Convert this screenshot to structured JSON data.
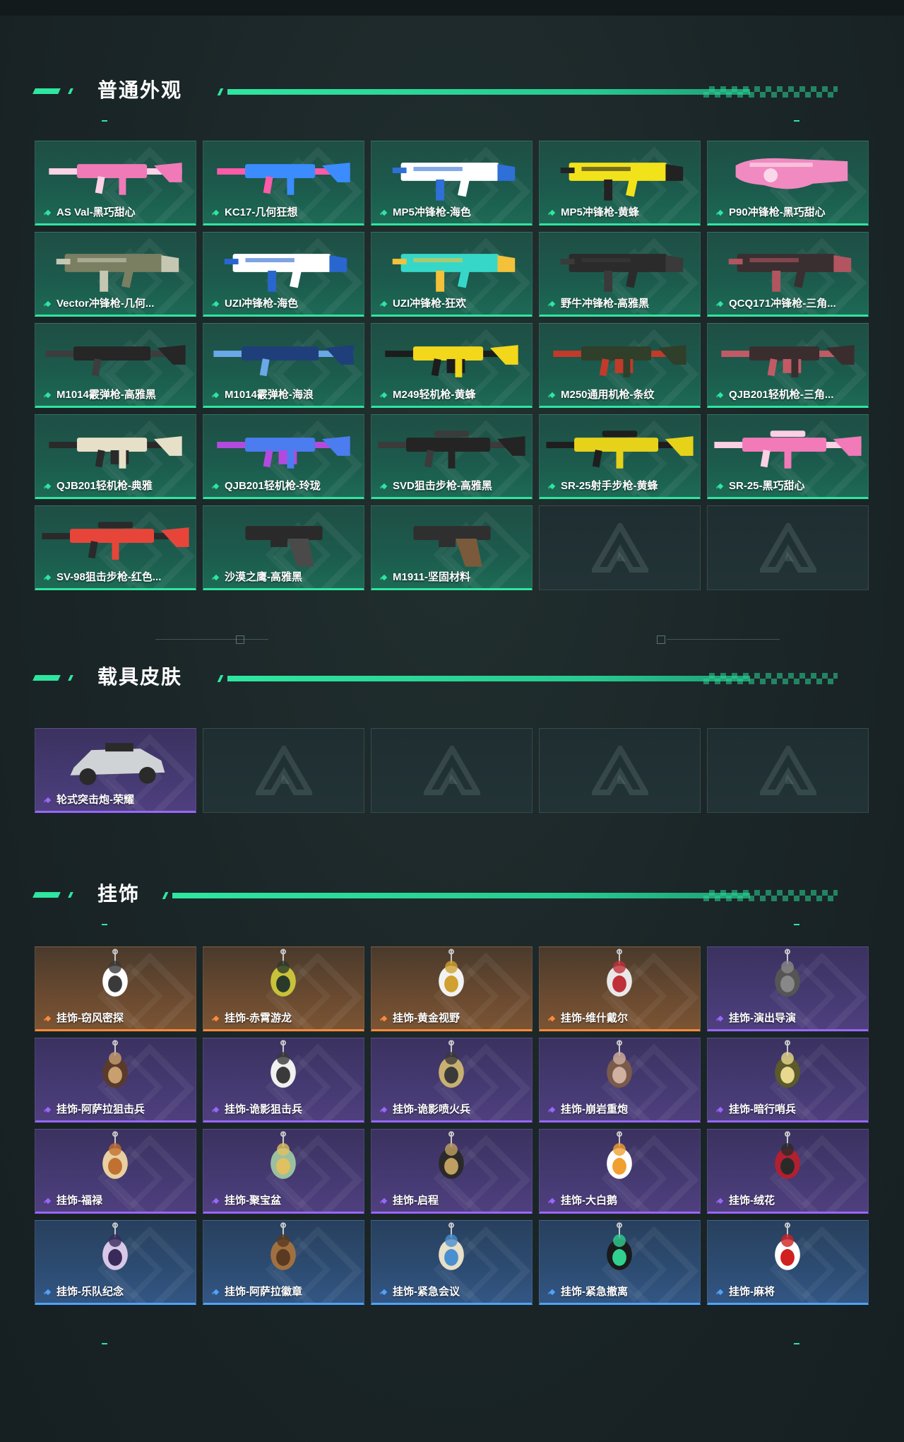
{
  "sections": [
    {
      "title": "普通外观",
      "rarity": "green",
      "items": [
        {
          "label": "AS Val-黑巧甜心",
          "kind": "rifle",
          "colors": [
            "#f07ab8",
            "#fbd2e6"
          ]
        },
        {
          "label": "KC17-几何狂想",
          "kind": "rifle",
          "colors": [
            "#3b8cff",
            "#ff5aa8"
          ]
        },
        {
          "label": "MP5冲锋枪-海色",
          "kind": "smg",
          "colors": [
            "#ffffff",
            "#2f6fd8"
          ]
        },
        {
          "label": "MP5冲锋枪-黄蜂",
          "kind": "smg",
          "colors": [
            "#f2e21a",
            "#222222"
          ]
        },
        {
          "label": "P90冲锋枪-黑巧甜心",
          "kind": "p90",
          "colors": [
            "#f08ac0",
            "#fbd7ea"
          ]
        },
        {
          "label": "Vector冲锋枪-几何...",
          "kind": "smg",
          "colors": [
            "#7a7f62",
            "#c6c7b3"
          ]
        },
        {
          "label": "UZI冲锋枪-海色",
          "kind": "smg",
          "colors": [
            "#ffffff",
            "#2a66d0"
          ]
        },
        {
          "label": "UZI冲锋枪-狂欢",
          "kind": "smg",
          "colors": [
            "#36d7c8",
            "#f3c13a"
          ]
        },
        {
          "label": "野牛冲锋枪-高雅黑",
          "kind": "smg",
          "colors": [
            "#2b2b2b",
            "#3a3a3a"
          ]
        },
        {
          "label": "QCQ171冲锋枪-三角...",
          "kind": "smg",
          "colors": [
            "#3a2f30",
            "#b25560"
          ]
        },
        {
          "label": "M1014霰弹枪-高雅黑",
          "kind": "shotgun",
          "colors": [
            "#262626",
            "#3d3d3d"
          ]
        },
        {
          "label": "M1014霰弹枪-海浪",
          "kind": "shotgun",
          "colors": [
            "#1f3f7a",
            "#6aa8e8"
          ]
        },
        {
          "label": "M249轻机枪-黄蜂",
          "kind": "lmg",
          "colors": [
            "#f2d71a",
            "#1c1c1c"
          ]
        },
        {
          "label": "M250通用机枪-条纹",
          "kind": "lmg",
          "colors": [
            "#2f3f2a",
            "#c23a2a"
          ]
        },
        {
          "label": "QJB201轻机枪-三角...",
          "kind": "lmg",
          "colors": [
            "#3a2d2e",
            "#c25a66"
          ]
        },
        {
          "label": "QJB201轻机枪-典雅",
          "kind": "lmg",
          "colors": [
            "#e7e0c8",
            "#2a2a2a"
          ]
        },
        {
          "label": "QJB201轻机枪-玲珑",
          "kind": "lmg",
          "colors": [
            "#4b7cf0",
            "#b34ae0"
          ]
        },
        {
          "label": "SVD狙击步枪-高雅黑",
          "kind": "sniper",
          "colors": [
            "#242424",
            "#3b3b3b"
          ]
        },
        {
          "label": "SR-25射手步枪-黄蜂",
          "kind": "sniper",
          "colors": [
            "#e7d21a",
            "#1e1e1e"
          ]
        },
        {
          "label": "SR-25-黑巧甜心",
          "kind": "sniper",
          "colors": [
            "#f27ab8",
            "#fbd0e4"
          ]
        },
        {
          "label": "SV-98狙击步枪-红色...",
          "kind": "sniper",
          "colors": [
            "#e8453a",
            "#2a2a2a"
          ]
        },
        {
          "label": "沙漠之鹰-高雅黑",
          "kind": "pistol",
          "colors": [
            "#2a2a2a",
            "#4a4a4a"
          ]
        },
        {
          "label": "M1911-坚固材料",
          "kind": "pistol",
          "colors": [
            "#2f2f2f",
            "#7a5a3a"
          ]
        },
        {
          "label": "",
          "kind": "empty"
        },
        {
          "label": "",
          "kind": "empty"
        }
      ]
    },
    {
      "title": "载具皮肤",
      "rarity": "purple",
      "items": [
        {
          "label": "轮式突击炮-荣耀",
          "kind": "vehicle",
          "colors": [
            "#cfd3d6",
            "#2a2a2a"
          ]
        },
        {
          "label": "",
          "kind": "empty"
        },
        {
          "label": "",
          "kind": "empty"
        },
        {
          "label": "",
          "kind": "empty"
        },
        {
          "label": "",
          "kind": "empty"
        }
      ]
    },
    {
      "title": "挂饰",
      "items": [
        {
          "label": "挂饰-窃风密探",
          "kind": "charm",
          "rarity": "orange",
          "colors": [
            "#ffffff",
            "#3a3a3a"
          ]
        },
        {
          "label": "挂饰-赤霄游龙",
          "kind": "charm",
          "rarity": "orange",
          "colors": [
            "#c8c23a",
            "#2a3a2a"
          ]
        },
        {
          "label": "挂饰-黄金视野",
          "kind": "charm",
          "rarity": "orange",
          "colors": [
            "#f2f2f2",
            "#d0a030"
          ]
        },
        {
          "label": "挂饰-维什戴尔",
          "kind": "charm",
          "rarity": "orange",
          "colors": [
            "#e8e8e8",
            "#c0303a"
          ]
        },
        {
          "label": "挂饰-演出导演",
          "kind": "charm",
          "rarity": "purple",
          "colors": [
            "#555555",
            "#888888"
          ]
        },
        {
          "label": "挂饰-阿萨拉狙击兵",
          "kind": "charm",
          "rarity": "purple",
          "colors": [
            "#5a3a2a",
            "#c8a070"
          ]
        },
        {
          "label": "挂饰-诡影狙击兵",
          "kind": "charm",
          "rarity": "purple",
          "colors": [
            "#f0f0f0",
            "#3a3a3a"
          ]
        },
        {
          "label": "挂饰-诡影喷火兵",
          "kind": "charm",
          "rarity": "purple",
          "colors": [
            "#c8b070",
            "#3a3a3a"
          ]
        },
        {
          "label": "挂饰-崩岩重炮",
          "kind": "charm",
          "rarity": "purple",
          "colors": [
            "#7a5a4a",
            "#d0b0a0"
          ]
        },
        {
          "label": "挂饰-暗行哨兵",
          "kind": "charm",
          "rarity": "purple",
          "colors": [
            "#5a5a2a",
            "#e8d890"
          ]
        },
        {
          "label": "挂饰-福禄",
          "kind": "charm",
          "rarity": "purple",
          "colors": [
            "#e8d0a0",
            "#c07030"
          ]
        },
        {
          "label": "挂饰-聚宝盆",
          "kind": "charm",
          "rarity": "purple",
          "colors": [
            "#9ac0a0",
            "#e0c060"
          ]
        },
        {
          "label": "挂饰-启程",
          "kind": "charm",
          "rarity": "purple",
          "colors": [
            "#2a2a2a",
            "#c0a060"
          ]
        },
        {
          "label": "挂饰-大白鹅",
          "kind": "charm",
          "rarity": "purple",
          "colors": [
            "#ffffff",
            "#f0a030"
          ]
        },
        {
          "label": "挂饰-绒花",
          "kind": "charm",
          "rarity": "purple",
          "colors": [
            "#b02030",
            "#2a2a2a"
          ]
        },
        {
          "label": "挂饰-乐队纪念",
          "kind": "charm",
          "rarity": "blue",
          "colors": [
            "#d8c8e8",
            "#3a2a5a"
          ]
        },
        {
          "label": "挂饰-阿萨拉徽章",
          "kind": "charm",
          "rarity": "blue",
          "colors": [
            "#a07040",
            "#5a3a20"
          ]
        },
        {
          "label": "挂饰-紧急会议",
          "kind": "charm",
          "rarity": "blue",
          "colors": [
            "#e8e0c8",
            "#4a90d0"
          ]
        },
        {
          "label": "挂饰-紧急撤离",
          "kind": "charm",
          "rarity": "blue",
          "colors": [
            "#1a1a1a",
            "#30d090"
          ]
        },
        {
          "label": "挂饰-麻将",
          "kind": "charm",
          "rarity": "blue",
          "colors": [
            "#ffffff",
            "#d02020"
          ]
        }
      ]
    }
  ],
  "theme": {
    "accent": "#2ee6a0",
    "rarity_colors": {
      "green": "#2ee6a0",
      "purple": "#9a66ff",
      "orange": "#ff8a3a",
      "blue": "#4fa3ff"
    }
  }
}
